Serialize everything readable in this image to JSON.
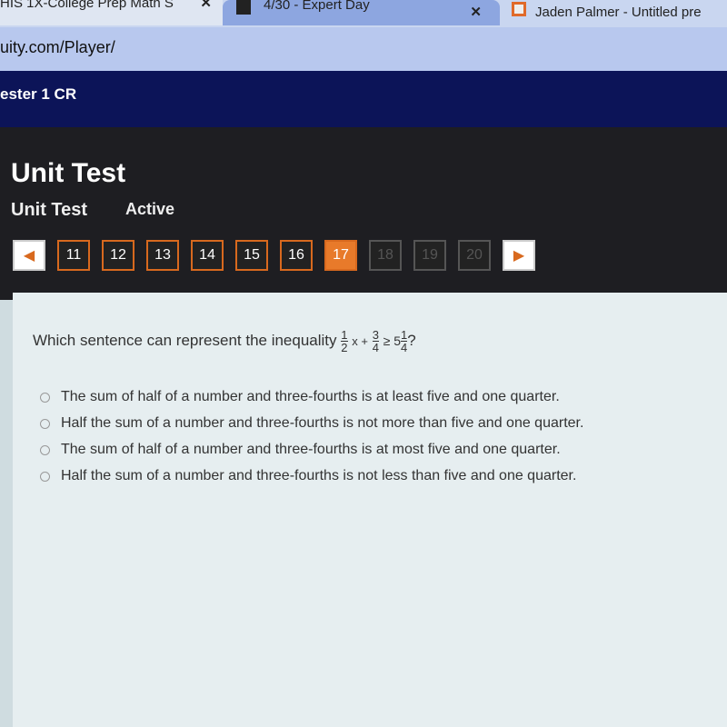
{
  "browser": {
    "tabs": [
      {
        "title": "HIS 1X-College Prep Math S"
      },
      {
        "title": "4/30 - Expert Day"
      },
      {
        "title": "Jaden Palmer - Untitled pre"
      }
    ],
    "url": "uity.com/Player/"
  },
  "course": {
    "title": "ester 1 CR"
  },
  "header": {
    "title": "Unit Test",
    "subtitle": "Unit Test",
    "status": "Active"
  },
  "nav": {
    "prev": "◀",
    "next": "▶",
    "pages": [
      "11",
      "12",
      "13",
      "14",
      "15",
      "16",
      "17",
      "18",
      "19",
      "20"
    ],
    "current": "17"
  },
  "question": {
    "text": "Which sentence can represent the inequality",
    "frac1": {
      "n": "1",
      "d": "2"
    },
    "mid1": "x +",
    "frac2": {
      "n": "3",
      "d": "4"
    },
    "mid2": "≥ 5",
    "frac3": {
      "n": "1",
      "d": "4"
    },
    "end": "?",
    "options": [
      "The sum of half of a number and three-fourths is at least five and one quarter.",
      "Half the sum of a number and three-fourths is not more than five and one quarter.",
      "The sum of half of a number and three-fourths is at most five and one quarter.",
      "Half the sum of a number and three-fourths is not less than five and one quarter."
    ]
  }
}
